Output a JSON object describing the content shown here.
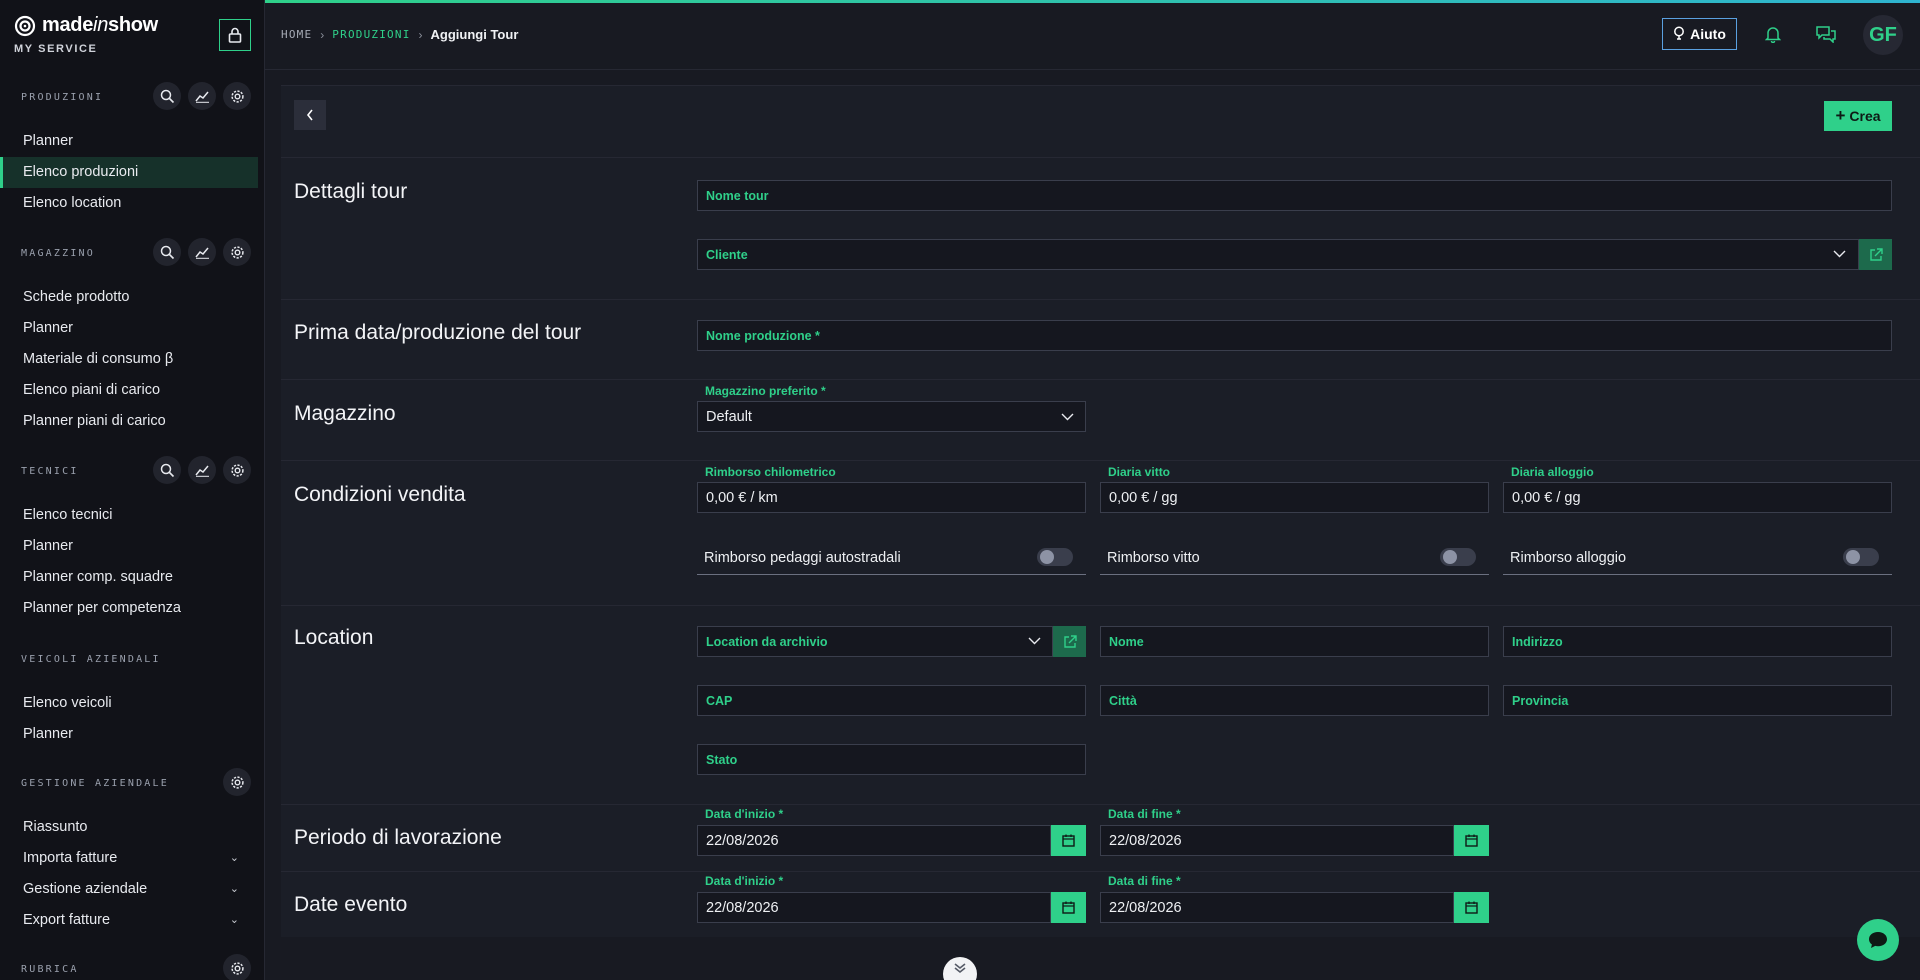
{
  "brand": {
    "name_main": "made",
    "name_italic": "in",
    "name_end": "show",
    "subtitle": "MY SERVICE"
  },
  "sidebar": {
    "sections": [
      {
        "title": "PRODUZIONI",
        "items": [
          "Planner",
          "Elenco produzioni",
          "Elenco location"
        ],
        "active": "Elenco produzioni"
      },
      {
        "title": "MAGAZZINO",
        "items": [
          "Schede prodotto",
          "Planner",
          "Materiale di consumo β",
          "Elenco piani di carico",
          "Planner piani di carico"
        ]
      },
      {
        "title": "TECNICI",
        "items": [
          "Elenco tecnici",
          "Planner",
          "Planner comp. squadre",
          "Planner per competenza"
        ]
      },
      {
        "title": "VEICOLI AZIENDALI",
        "items": [
          "Elenco veicoli",
          "Planner"
        ]
      },
      {
        "title": "GESTIONE AZIENDALE",
        "items": [
          "Riassunto",
          "Importa fatture",
          "Gestione aziendale",
          "Export fatture"
        ]
      },
      {
        "title": "RUBRICA",
        "items": []
      }
    ]
  },
  "breadcrumb": {
    "home": "HOME",
    "section": "PRODUZIONI",
    "current": "Aggiungi Tour"
  },
  "topbar": {
    "help_label": "Aiuto",
    "avatar_initials": "GF"
  },
  "toolbar": {
    "create_label": "Crea"
  },
  "form": {
    "dettagli": {
      "title": "Dettagli tour",
      "nome_tour": "Nome tour",
      "cliente": "Cliente"
    },
    "prima_data": {
      "title": "Prima data/produzione del tour",
      "nome_produzione": "Nome produzione *"
    },
    "magazzino": {
      "title": "Magazzino",
      "label": "Magazzino preferito *",
      "value": "Default"
    },
    "condizioni": {
      "title": "Condizioni vendita",
      "rimborso_km_label": "Rimborso chilometrico",
      "rimborso_km_value": "0,00 € / km",
      "diaria_vitto_label": "Diaria vitto",
      "diaria_vitto_value": "0,00 € / gg",
      "diaria_alloggio_label": "Diaria alloggio",
      "diaria_alloggio_value": "0,00 € / gg",
      "toggle_pedaggi": "Rimborso pedaggi autostradali",
      "toggle_vitto": "Rimborso vitto",
      "toggle_alloggio": "Rimborso alloggio"
    },
    "location": {
      "title": "Location",
      "archivio": "Location da archivio",
      "nome": "Nome",
      "indirizzo": "Indirizzo",
      "cap": "CAP",
      "citta": "Città",
      "provincia": "Provincia",
      "stato": "Stato"
    },
    "periodo": {
      "title": "Periodo di lavorazione",
      "start_label": "Data d'inizio *",
      "start_value": "22/08/2026",
      "end_label": "Data di fine *",
      "end_value": "22/08/2026"
    },
    "evento": {
      "title": "Date evento",
      "start_label": "Data d'inizio *",
      "start_value": "22/08/2026",
      "end_label": "Data di fine *",
      "end_value": "22/08/2026"
    }
  },
  "colors": {
    "accent": "#2fd08a",
    "background": "#181a22",
    "sidebar": "#111218",
    "panel": "#1b1e27"
  }
}
